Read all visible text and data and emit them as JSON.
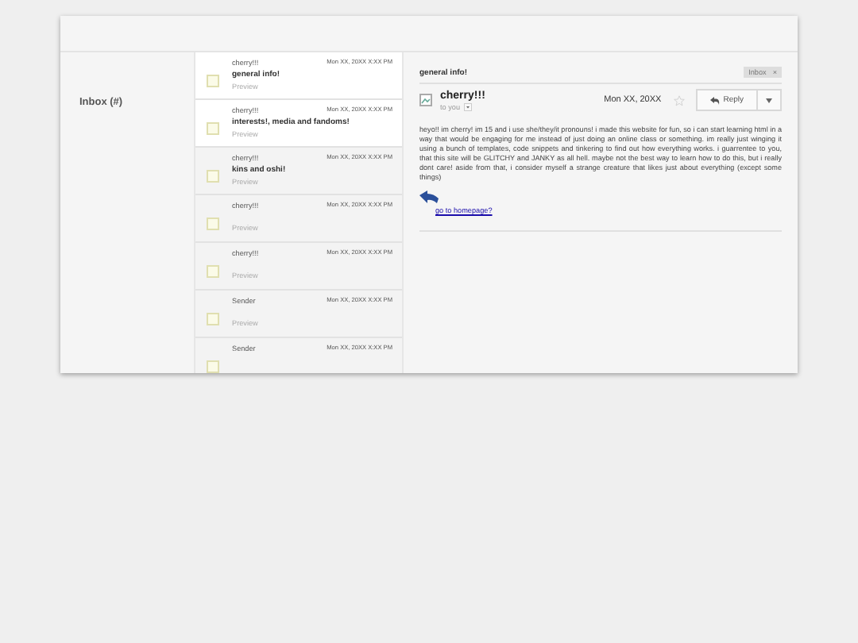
{
  "sidebar": {
    "label": "Inbox (#)"
  },
  "messages": [
    {
      "sender": "cherry!!!",
      "date": "Mon XX, 20XX X:XX PM",
      "subject": "general info!",
      "preview": "Preview",
      "unread": true,
      "checked": false
    },
    {
      "sender": "cherry!!!",
      "date": "Mon XX, 20XX X:XX PM",
      "subject": "interests!, media and fandoms!",
      "preview": "Preview",
      "unread": true,
      "checked": false
    },
    {
      "sender": "cherry!!!",
      "date": "Mon XX, 20XX X:XX PM",
      "subject": "kins and oshi!",
      "preview": "Preview",
      "unread": false,
      "checked": false
    },
    {
      "sender": "cherry!!!",
      "date": "Mon XX, 20XX X:XX PM",
      "preview": "Preview",
      "unread": false,
      "checked": false
    },
    {
      "sender": "cherry!!!",
      "date": "Mon XX, 20XX X:XX PM",
      "preview": "Preview",
      "unread": false,
      "checked": false
    },
    {
      "sender": "Sender",
      "date": "Mon XX, 20XX X:XX PM",
      "preview": "Preview",
      "unread": false,
      "checked": false
    },
    {
      "sender": "Sender",
      "date": "Mon XX, 20XX X:XX PM",
      "unread": false,
      "checked": false
    }
  ],
  "reader": {
    "subject": "general info!",
    "label": "Inbox",
    "label_close": "×",
    "from": "cherry!!!",
    "to": "to you",
    "date": "Mon XX, 20XX",
    "starred": false,
    "reply": "Reply",
    "body": "heyo!! im cherry! im 15 and i use she/they/it pronouns! i made this website for fun, so i can start learning html in a way that would be engaging for me instead of just doing an online class or something. im really just winging it using a bunch of templates, code snippets and tinkering to find out how everything works. i guarrentee to you, that this site will be GLITCHY and JANKY as all hell. maybe not the best way to learn how to do this, but i really dont care! aside from that, i consider myself a strange creature that likes just about everything (except some things)",
    "link": "go to homepage?"
  }
}
